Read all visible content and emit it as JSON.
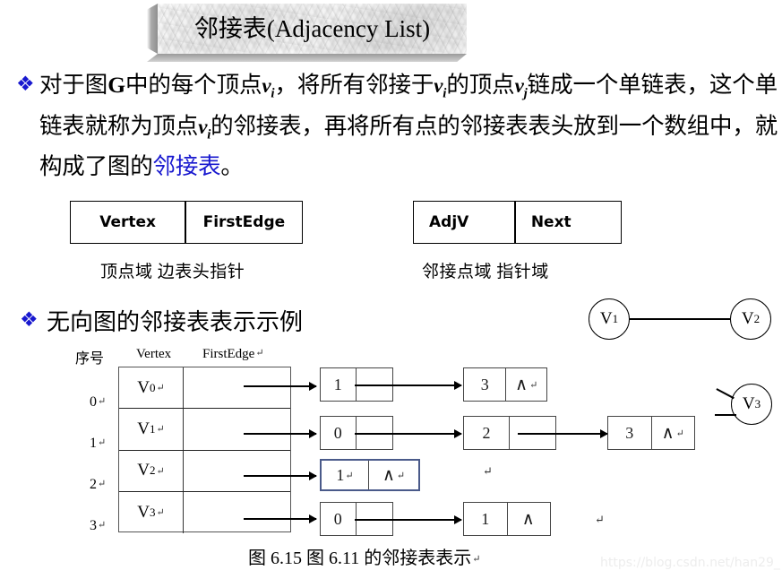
{
  "slide": {
    "title": "邻接表(Adjacency List)",
    "bullet_glyph": "❖"
  },
  "paragraph": {
    "seg1": "对于图",
    "g": "G",
    "seg2": "中的每个顶点",
    "vi1": "v",
    "vi1_sub": "i",
    "seg3": "，将所有邻接于",
    "vi2": "v",
    "vi2_sub": "i",
    "seg4": "的顶点",
    "vj": "v",
    "vj_sub": "j",
    "seg5": "链成一个单链表，这个单链表就称为顶点",
    "vi3": "v",
    "vi3_sub": "i",
    "seg6": "的邻接表，再将所有点的邻接表表头放到一个数组中，就构成了图的",
    "highlight": "邻接表",
    "seg7": "。",
    "highlight_color": "#1818cf"
  },
  "vertex_struct": {
    "cells": [
      "Vertex",
      "FirstEdge"
    ],
    "caption": "顶点域   边表头指针"
  },
  "node_struct": {
    "cells": [
      "AdjV",
      "Next"
    ],
    "caption": "邻接点域     指针域"
  },
  "bullet2": {
    "text": "无向图的邻接表表示示例"
  },
  "diagram": {
    "headers": {
      "index": "序号",
      "vertex": "Vertex",
      "firstedge": "FirstEdge",
      "firstedge_pilcrow": "↵"
    },
    "pilcrow": "↵",
    "nil": "∧",
    "rows": [
      {
        "index": "0",
        "index_pilcrow": "↵",
        "vertex": "V",
        "vertex_sub": "0",
        "vertex_pilcrow": "↵",
        "nodes": [
          {
            "value": "1",
            "next": "pointer"
          },
          {
            "value": "3",
            "next": "nil",
            "nil_pilcrow": "↵"
          }
        ]
      },
      {
        "index": "1",
        "index_pilcrow": "↵",
        "vertex": "V",
        "vertex_sub": "1",
        "vertex_pilcrow": "↵",
        "nodes": [
          {
            "value": "0",
            "next": "pointer"
          },
          {
            "value": "2",
            "next": "pointer"
          },
          {
            "value": "3",
            "next": "nil",
            "nil_pilcrow": "↵"
          }
        ]
      },
      {
        "index": "2",
        "index_pilcrow": "↵",
        "vertex": "V",
        "vertex_sub": "2",
        "vertex_pilcrow": "↵",
        "nodes": [
          {
            "value": "1",
            "value_pilcrow": "↵",
            "next": "nil",
            "nil_pilcrow": "↵",
            "highlight": true
          }
        ],
        "trailing_pilcrow": "↵"
      },
      {
        "index": "3",
        "index_pilcrow": "↵",
        "vertex": "V",
        "vertex_sub": "3",
        "vertex_pilcrow": "↵",
        "nodes": [
          {
            "value": "0",
            "next": "pointer"
          },
          {
            "value": "1",
            "next": "nil"
          }
        ],
        "trailing_pilcrow": "↵"
      }
    ]
  },
  "graph": {
    "nodes": [
      {
        "label": "V",
        "sub": "1"
      },
      {
        "label": "V",
        "sub": "2"
      },
      {
        "label": "V",
        "sub": "3"
      }
    ]
  },
  "figure_caption": {
    "text": "图 6.15    图 6.11 的邻接表表示",
    "pilcrow": "↵"
  },
  "watermark": {
    "text": "https://blog.csdn.net/han29_"
  }
}
